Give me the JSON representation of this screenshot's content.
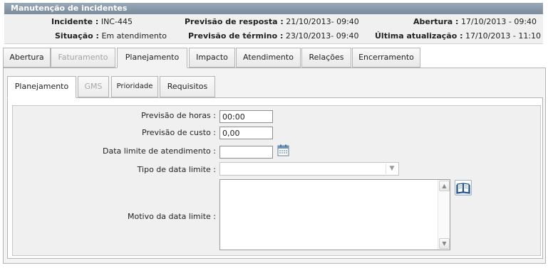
{
  "window": {
    "title": "Manutenção de incidentes"
  },
  "info": {
    "incidente_label": "Incidente :",
    "incidente_value": "INC-445",
    "previsao_resposta_label": "Previsão de resposta :",
    "previsao_resposta_value": "21/10/2013- 09:40",
    "abertura_label": "Abertura :",
    "abertura_value": "17/10/2013 - 09:40",
    "situacao_label": "Situação :",
    "situacao_value": "Em atendimento",
    "previsao_termino_label": "Previsão de término :",
    "previsao_termino_value": "23/10/2013- 09:40",
    "ultima_atualizacao_label": "Última atualização :",
    "ultima_atualizacao_value": "17/10/2013 - 11:10"
  },
  "tabs": [
    {
      "label": "Abertura"
    },
    {
      "label": "Faturamento"
    },
    {
      "label": "Planejamento"
    },
    {
      "label": "Impacto"
    },
    {
      "label": "Atendimento"
    },
    {
      "label": "Relações"
    },
    {
      "label": "Encerramento"
    }
  ],
  "subtabs": [
    {
      "label": "Planejamento"
    },
    {
      "label": "GMS"
    },
    {
      "label": "Prioridade"
    },
    {
      "label": "Requisitos"
    }
  ],
  "form": {
    "previsao_horas_label": "Previsão de horas :",
    "previsao_horas_value": "00:00",
    "previsao_custo_label": "Previsão de custo :",
    "previsao_custo_value": "0,00",
    "data_limite_label": "Data limite de atendimento :",
    "data_limite_value": "",
    "tipo_data_label": "Tipo de data limite :",
    "tipo_data_value": "",
    "motivo_label": "Motivo da data limite :",
    "motivo_value": ""
  },
  "icons": {
    "calendar": "calendar-icon",
    "book": "book-icon",
    "dropdown": "chevron-down-icon",
    "scroll_up": "scroll-up-icon",
    "scroll_down": "scroll-down-icon"
  },
  "colors": {
    "titlebar": "#8596a8",
    "panel": "#f3f3f3",
    "form_bg": "#f0f0f0",
    "disabled_text": "#a4a4a4"
  }
}
